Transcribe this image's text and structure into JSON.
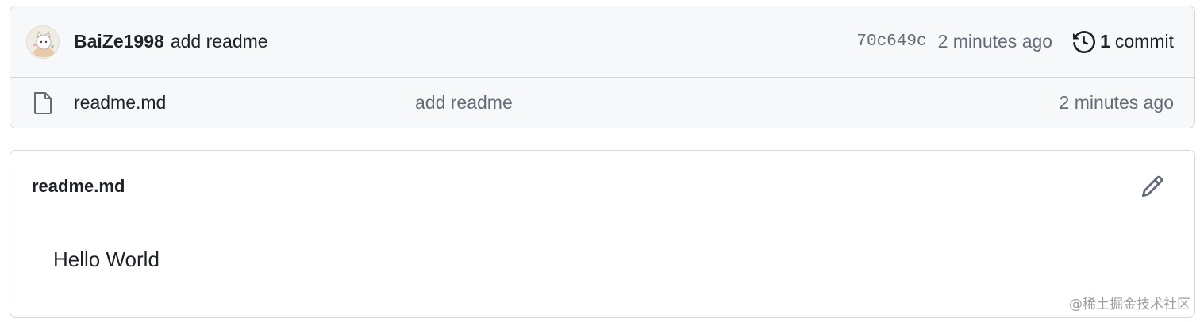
{
  "latest_commit": {
    "author": "BaiZe1998",
    "message": "add readme",
    "sha": "70c649c",
    "time": "2 minutes ago",
    "history_icon": "history-icon",
    "commit_count": "1",
    "commit_word": "commit"
  },
  "files": [
    {
      "icon": "file-icon",
      "name": "readme.md",
      "message": "add readme",
      "time": "2 minutes ago"
    }
  ],
  "readme": {
    "title": "readme.md",
    "edit_icon": "pencil-icon",
    "content": "Hello World"
  },
  "watermark": "@稀土掘金技术社区",
  "colors": {
    "border": "#d0d7de",
    "header_bg": "#f6f8fa",
    "muted_text": "#636c76",
    "text": "#1f2328"
  }
}
